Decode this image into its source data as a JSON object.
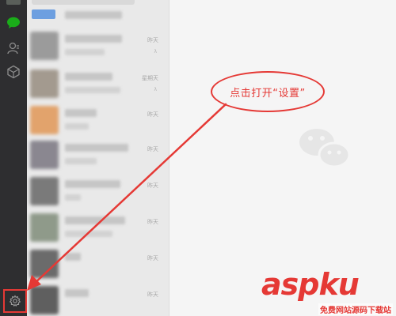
{
  "annotation": {
    "callout_text": "点击打开“设置”"
  },
  "conversations": [
    {
      "time": "",
      "note": "",
      "color": "#6d9fe0"
    },
    {
      "time": "昨天",
      "note": "λ",
      "color": "#9b9b9b"
    },
    {
      "time": "星期天",
      "note": "λ",
      "color": "#a39a8f"
    },
    {
      "time": "昨天",
      "note": "",
      "color": "#e2a36c"
    },
    {
      "time": "昨天",
      "note": "",
      "color": "#8a8790"
    },
    {
      "time": "昨天",
      "note": "",
      "color": "#7a7a7a"
    },
    {
      "time": "昨天",
      "note": "",
      "color": "#8f9a8a"
    },
    {
      "time": "昨天",
      "note": "",
      "color": "#6b6b6b"
    },
    {
      "time": "昨天",
      "note": "",
      "color": "#5f5f5f"
    }
  ],
  "rail": {
    "icons": [
      "chat-icon",
      "contacts-icon",
      "favorites-icon",
      "settings-icon"
    ],
    "active_color": "#1aad19"
  },
  "watermark": {
    "logo": "aspku",
    "subtitle": "免费网站源码下载站"
  },
  "colors": {
    "annotation": "#e53935",
    "rail_bg": "#2e2e30",
    "list_bg": "#e9e9e9"
  }
}
